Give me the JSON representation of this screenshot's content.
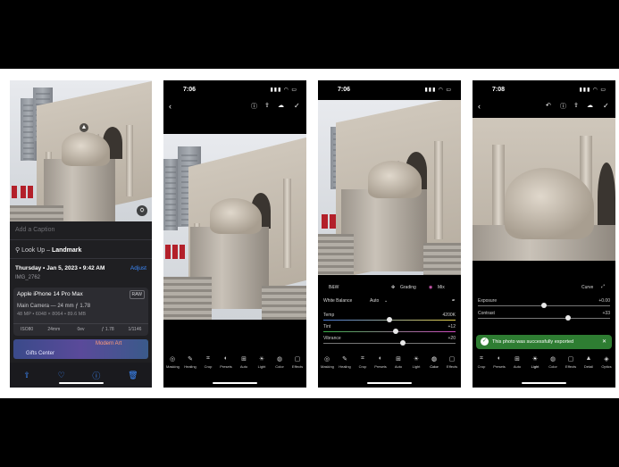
{
  "panel1": {
    "caption_placeholder": "Add a Caption",
    "lookup_prefix": "Look Up –",
    "lookup_value": "Landmark",
    "date": "Thursday • Jan 5, 2023 • 9:42 AM",
    "adjust": "Adjust",
    "image_name": "IMG_2762",
    "camera_model": "Apple iPhone 14 Pro Max",
    "raw_badge": "RAW",
    "lens": "Main Camera — 24 mm ƒ 1.78",
    "resolution": "48 MP • 6048 × 8064 • 89.6 MB",
    "exif": [
      "ISO80",
      "24mm",
      "0ev",
      "ƒ 1.78",
      "1/1146"
    ],
    "map_labels": [
      "Modern Art",
      "Gifts Center"
    ]
  },
  "panel2": {
    "time": "7:06"
  },
  "panel3": {
    "time": "7:06",
    "tab_bw": "B&W",
    "tab_grading": "Grading",
    "tab_mix": "Mix",
    "white_balance_label": "White Balance",
    "white_balance_value": "Auto",
    "sliders": [
      {
        "label": "Temp",
        "value": "4200K",
        "pos": 0.5
      },
      {
        "label": "Tint",
        "value": "+12",
        "pos": 0.55
      },
      {
        "label": "Vibrance",
        "value": "+20",
        "pos": 0.6
      }
    ],
    "tools": [
      "Masking",
      "Healing",
      "Crop",
      "Presets",
      "Auto",
      "Light",
      "Color",
      "Effects"
    ]
  },
  "panel4": {
    "time": "7:08",
    "curve_label": "Curve",
    "sliders": [
      {
        "label": "Exposure",
        "value": "+0.00",
        "pos": 0.5
      },
      {
        "label": "Contrast",
        "value": "+33",
        "pos": 0.68
      }
    ],
    "toast": "This photo was successfully exported",
    "tools": [
      "Crop",
      "Presets",
      "Auto",
      "Light",
      "Color",
      "Effects",
      "Detail",
      "Optics"
    ]
  },
  "panel2_tools": [
    "Masking",
    "Healing",
    "Crop",
    "Presets",
    "Auto",
    "Light",
    "Color",
    "Effects"
  ]
}
